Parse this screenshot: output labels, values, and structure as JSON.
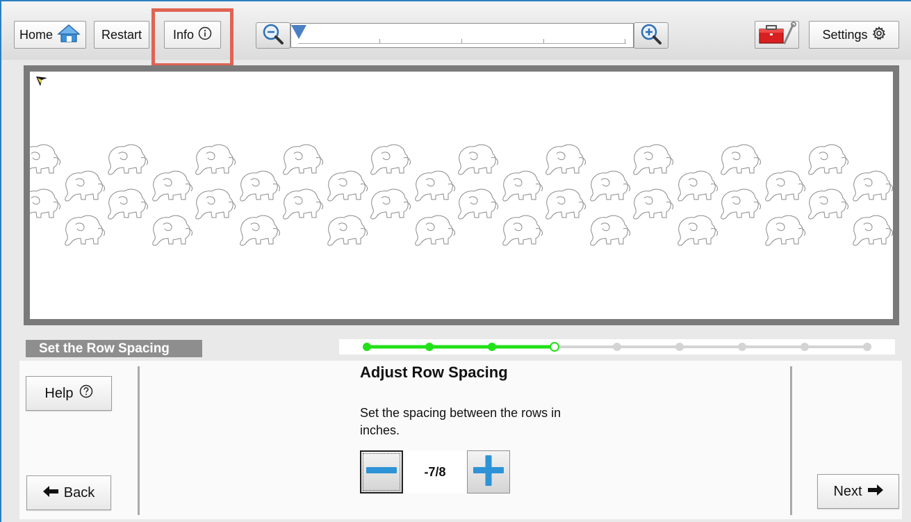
{
  "toolbar": {
    "home_label": "Home",
    "restart_label": "Restart",
    "info_label": "Info",
    "settings_label": "Settings"
  },
  "icons": {
    "home": "home-icon",
    "info": "info-circle-icon",
    "zoom_out": "zoom-out-icon",
    "zoom_in": "zoom-in-icon",
    "toolbox": "toolbox-icon",
    "settings": "gear-icon",
    "help": "help-circle-icon",
    "back": "arrow-left-icon",
    "next": "arrow-right-icon",
    "minus": "minus-icon",
    "plus": "plus-icon"
  },
  "zoom": {
    "level": 0
  },
  "step": {
    "label": "Set the Row Spacing",
    "progress_total": 9,
    "progress_completed": 3,
    "progress_current": 4
  },
  "panel": {
    "title": "Adjust Row Spacing",
    "description": "Set the spacing between the rows in inches.",
    "spacing_value": "-7/8",
    "help_label": "Help",
    "back_label": "Back",
    "next_label": "Next"
  },
  "colors": {
    "accent_frame": "#2a7fc0",
    "highlight": "#e06352",
    "progress_done": "#22e01a",
    "progress_pending": "#d4d4d4",
    "stepper_icon": "#2e93d6",
    "slider_thumb": "#4a7fc4"
  }
}
